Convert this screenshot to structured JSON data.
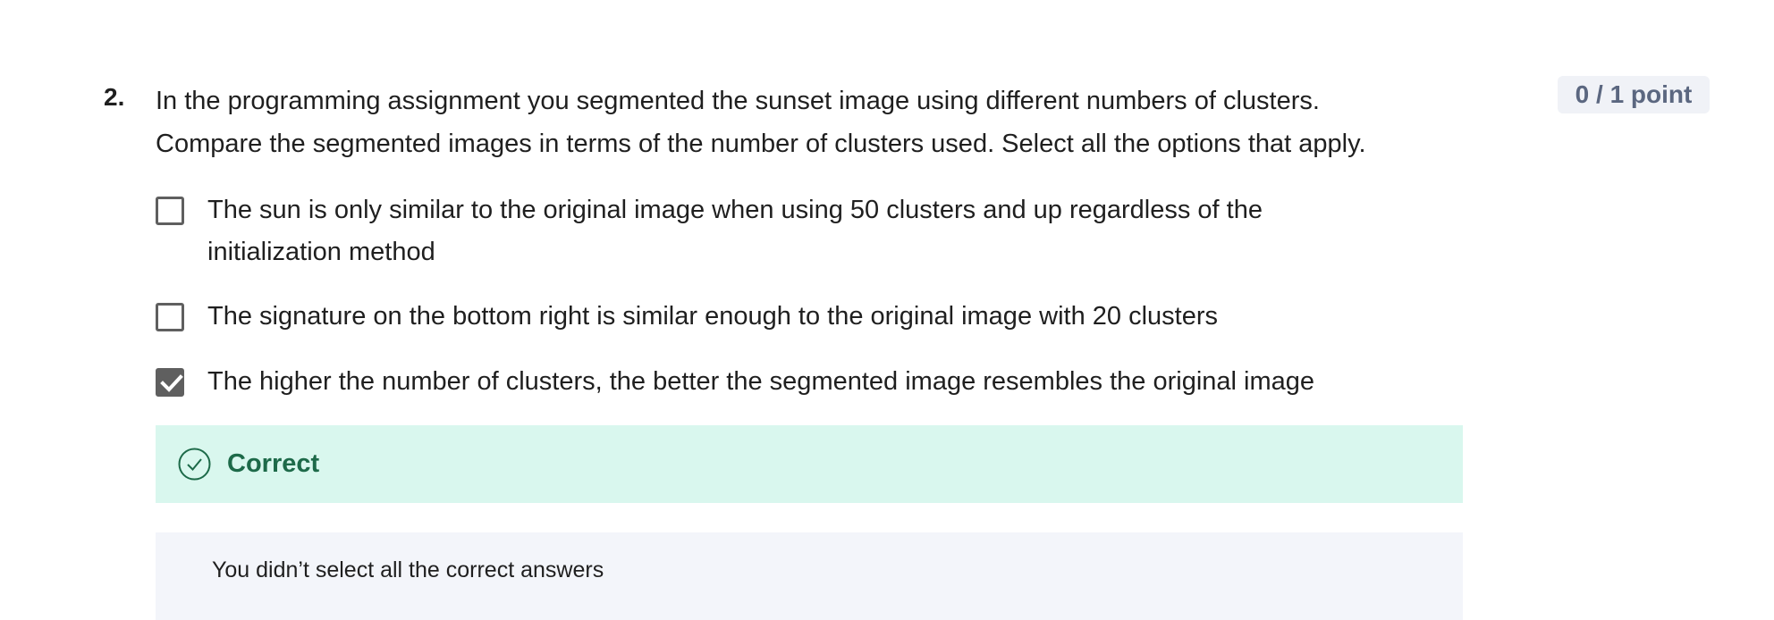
{
  "question": {
    "number": "2.",
    "text_lines": [
      "In the programming assignment you segmented the sunset image using different numbers of clusters.",
      "Compare the segmented images in terms of the number of clusters used. Select all the options that apply."
    ],
    "points": "0 / 1 point"
  },
  "options": [
    {
      "lines": [
        "The sun is only similar to the original image when using 50 clusters and up regardless of the",
        "initialization method"
      ],
      "checked": false
    },
    {
      "lines": [
        "The signature on the bottom right is similar enough to the original image with 20 clusters"
      ],
      "checked": false
    },
    {
      "lines": [
        "The higher the number of clusters, the better the segmented image resembles the original image"
      ],
      "checked": true
    }
  ],
  "feedback": {
    "status": "Correct",
    "icon": "check-circle-icon",
    "color": "#1d6a49",
    "background": "#d9f7ee"
  },
  "explanation": {
    "text": "You didn’t select all the correct answers"
  }
}
